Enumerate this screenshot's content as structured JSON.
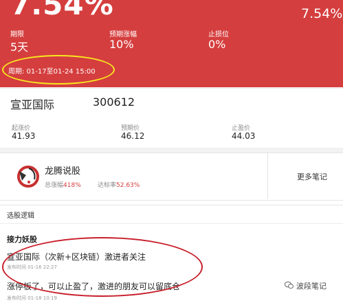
{
  "header": {
    "big_percent": "7.54%",
    "right_percent": "7.54%",
    "metrics": [
      {
        "label": "期限",
        "value": "5天"
      },
      {
        "label": "预期涨幅",
        "value": "10%"
      },
      {
        "label": "止损位",
        "value": "0%"
      }
    ],
    "period": "周期: 01-17至01-24 15:00"
  },
  "stock": {
    "name": "宣亚国际",
    "code": "300612",
    "prices": [
      {
        "label": "起涨价",
        "value": "41.93"
      },
      {
        "label": "预期价",
        "value": "46.12"
      },
      {
        "label": "止盈价",
        "value": "44.03"
      }
    ]
  },
  "author": {
    "name": "龙腾说股",
    "total_label": "总涨幅",
    "total_value": "418%",
    "rate_label": "达标率",
    "rate_value": "52.63%",
    "more_notes": "更多笔记"
  },
  "logic": {
    "header": "选股逻辑",
    "title": "接力妖股",
    "notes": [
      {
        "text": "宣亚国际（次新+区块链）激进者关注",
        "time": "发布时间 01-16 22:27"
      },
      {
        "text": "涨停板了，可以止盈了，激进的朋友可以留底仓",
        "time": "发布时间 01-18 10:19"
      }
    ]
  },
  "watermark": "波段笔记",
  "colors": {
    "header_red": "#d53e3e",
    "highlight_yellow": "#f7e81e",
    "highlight_red": "#c81e2a",
    "stat_red": "#d53e3e"
  }
}
